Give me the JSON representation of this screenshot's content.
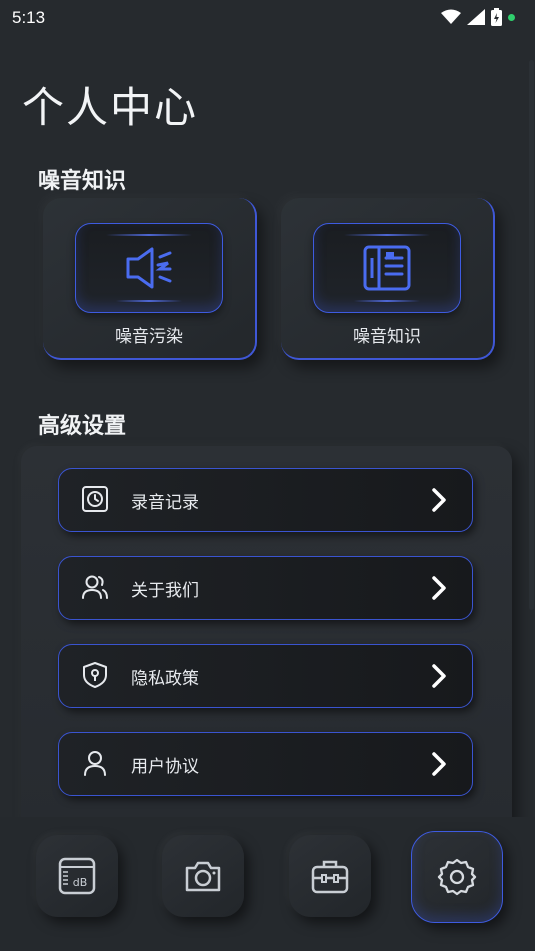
{
  "status_bar": {
    "time": "5:13",
    "icons": [
      "wifi-icon",
      "signal-icon",
      "battery-icon",
      "notification-dot"
    ]
  },
  "page": {
    "title": "个人中心"
  },
  "knowledge": {
    "title": "噪音知识",
    "cards": [
      {
        "label": "噪音污染",
        "icon": "speaker-noise-icon"
      },
      {
        "label": "噪音知识",
        "icon": "book-icon"
      }
    ]
  },
  "settings": {
    "title": "高级设置",
    "items": [
      {
        "label": "录音记录",
        "icon": "clock-icon"
      },
      {
        "label": "关于我们",
        "icon": "users-icon"
      },
      {
        "label": "隐私政策",
        "icon": "shield-icon"
      },
      {
        "label": "用户协议",
        "icon": "user-icon"
      }
    ]
  },
  "bottom_nav": {
    "items": [
      {
        "icon": "db-meter-icon",
        "label": "dB"
      },
      {
        "icon": "camera-icon"
      },
      {
        "icon": "toolbox-icon"
      },
      {
        "icon": "settings-gear-icon",
        "active": true
      }
    ]
  },
  "colors": {
    "accent": "#3e5be0",
    "background": "#262a2e",
    "status_dot": "#2fcf6d"
  }
}
